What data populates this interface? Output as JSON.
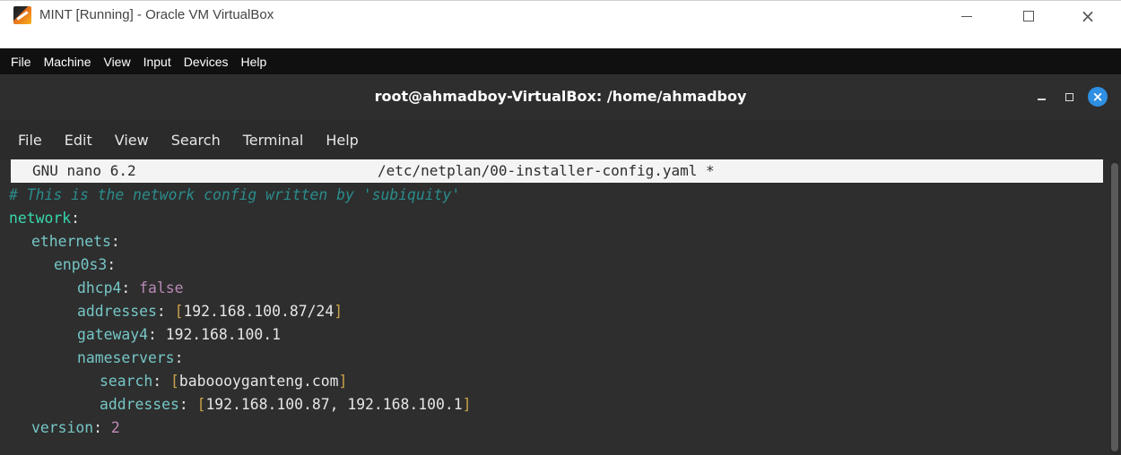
{
  "host_window": {
    "title": "MINT [Running] - Oracle VM VirtualBox",
    "menu": [
      "File",
      "Machine",
      "View",
      "Input",
      "Devices",
      "Help"
    ]
  },
  "terminal": {
    "title": "root@ahmadboy-VirtualBox: /home/ahmadboy",
    "menu": [
      "File",
      "Edit",
      "View",
      "Search",
      "Terminal",
      "Help"
    ],
    "close_symbol": "×"
  },
  "nano": {
    "version": "GNU nano 6.2",
    "file": "/etc/netplan/00-installer-config.yaml *"
  },
  "file_content": {
    "comment": "# This is the network config written by 'subiquity'",
    "network_key": "network",
    "ethernets_key": "ethernets",
    "interface_key": "enp0s3",
    "dhcp4_key": "dhcp4",
    "dhcp4_value": "false",
    "addresses_key": "addresses",
    "addresses_value": "192.168.100.87/24",
    "gateway4_key": "gateway4",
    "gateway4_value": "192.168.100.1",
    "nameservers_key": "nameservers",
    "search_key": "search",
    "search_value": "baboooyganteng.com",
    "ns_addresses_key": "addresses",
    "ns_addresses_value": "192.168.100.87, 192.168.100.1",
    "version_key": "version",
    "version_value": "2"
  },
  "colors": {
    "comment": "#2b8c8c",
    "key": "#76c6c6",
    "boolean": "#b889b5",
    "bracket": "#c9a24a",
    "terminal_bg": "#2e2e2e",
    "close_button": "#2f8fe3"
  }
}
